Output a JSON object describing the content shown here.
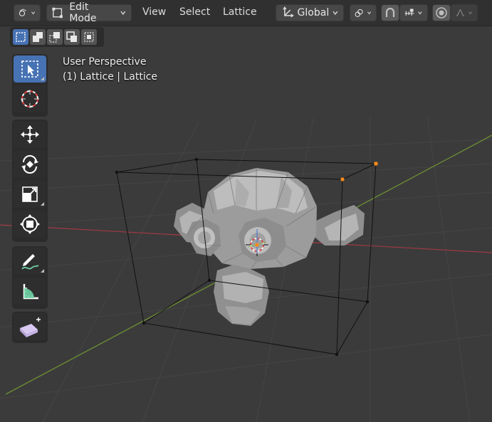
{
  "header": {
    "mode_label": "Edit Mode",
    "menus": [
      "View",
      "Select",
      "Lattice"
    ],
    "transform_orientation": "Global"
  },
  "viewport": {
    "view_name": "User Perspective",
    "object_info": "(1) Lattice | Lattice"
  },
  "toolbar": {
    "tools": [
      {
        "name": "select-box",
        "icon": "select-box-icon",
        "active": true
      },
      {
        "name": "cursor",
        "icon": "cursor-icon"
      },
      {
        "name": "move",
        "icon": "move-icon"
      },
      {
        "name": "rotate",
        "icon": "rotate-icon"
      },
      {
        "name": "scale",
        "icon": "scale-icon"
      },
      {
        "name": "transform",
        "icon": "transform-icon"
      },
      {
        "name": "annotate",
        "icon": "annotate-icon"
      },
      {
        "name": "measure",
        "icon": "measure-icon"
      },
      {
        "name": "add-cube",
        "icon": "add-cube-icon"
      }
    ]
  },
  "selection_modes": [
    "set",
    "extend",
    "subtract",
    "difference",
    "intersect"
  ],
  "colors": {
    "header_bg": "#303030",
    "viewport_bg": "#3b3b3b",
    "accent_blue": "#4772b3",
    "x_axis": "#9e3a45",
    "y_axis": "#6d8f34",
    "selected_vertex": "#ff8c1a"
  }
}
